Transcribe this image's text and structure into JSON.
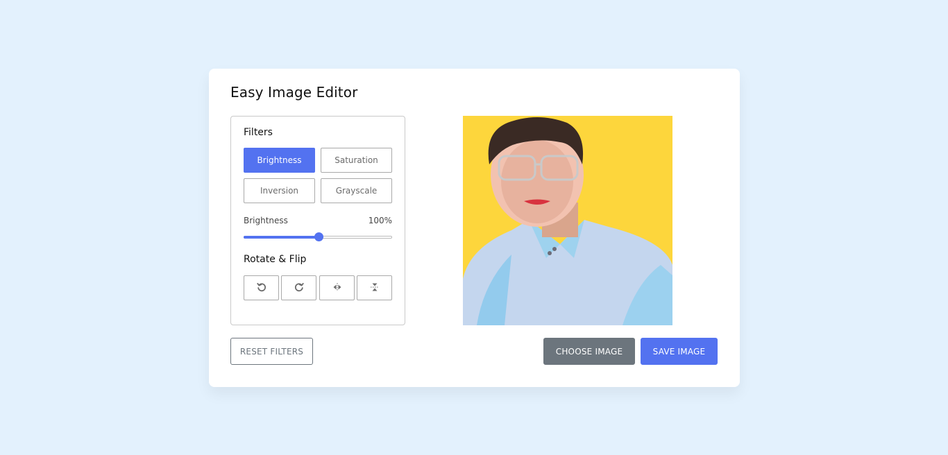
{
  "app": {
    "title": "Easy Image Editor"
  },
  "filters": {
    "heading": "Filters",
    "buttons": [
      {
        "label": "Brightness",
        "active": true
      },
      {
        "label": "Saturation",
        "active": false
      },
      {
        "label": "Inversion",
        "active": false
      },
      {
        "label": "Grayscale",
        "active": false
      }
    ],
    "slider": {
      "name": "Brightness",
      "value_text": "100%",
      "value": 100,
      "max": 200
    }
  },
  "rotate_flip": {
    "heading": "Rotate & Flip",
    "icons": [
      "rotate-left-icon",
      "rotate-right-icon",
      "flip-horizontal-icon",
      "flip-vertical-icon"
    ]
  },
  "preview": {
    "icon": "preview-image"
  },
  "actions": {
    "reset": "RESET FILTERS",
    "choose": "CHOOSE IMAGE",
    "save": "SAVE IMAGE"
  },
  "colors": {
    "accent": "#5372f0",
    "secondary": "#6c757d",
    "background": "#e3f1fd",
    "image_background": "#fdd63c"
  }
}
